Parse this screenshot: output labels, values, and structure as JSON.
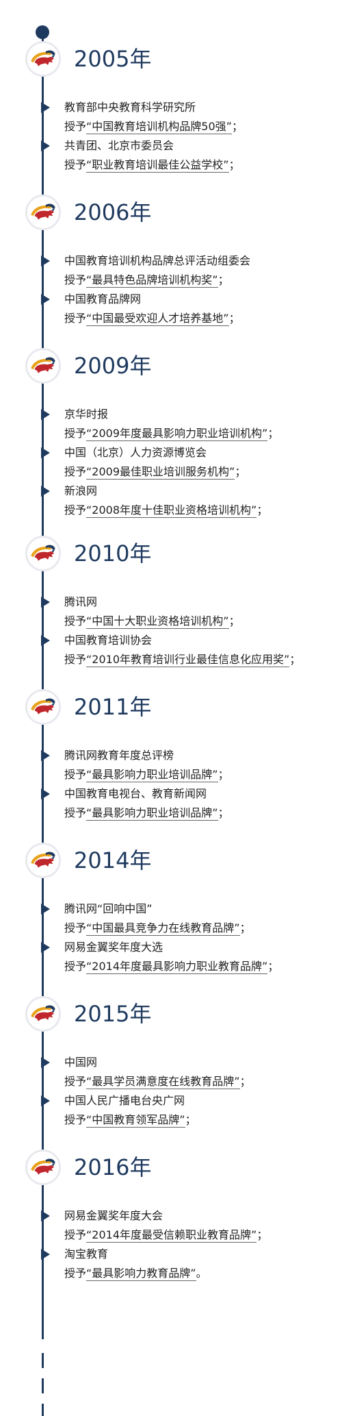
{
  "timeline": [
    {
      "year": "2005年",
      "entries": [
        {
          "source": "教育部中央教育科学研究所",
          "prefix": "授予",
          "award": "“中国教育培训机构品牌50强”",
          "suffix": "；"
        },
        {
          "source": "共青团、北京市委员会",
          "prefix": "授予",
          "award": "“职业教育培训最佳公益学校”",
          "suffix": "；"
        }
      ]
    },
    {
      "year": "2006年",
      "entries": [
        {
          "source": "中国教育培训机构品牌总评活动组委会",
          "prefix": "授予",
          "award": "“最具特色品牌培训机构奖”",
          "suffix": "；"
        },
        {
          "source": "中国教育品牌网",
          "prefix": "授予",
          "award": "“中国最受欢迎人才培养基地”",
          "suffix": "；"
        }
      ]
    },
    {
      "year": "2009年",
      "entries": [
        {
          "source": "京华时报",
          "prefix": "授予",
          "award": "“2009年度最具影响力职业培训机构”",
          "suffix": "；"
        },
        {
          "source": "中国（北京）人力资源博览会",
          "prefix": "授予",
          "award": "“2009最佳职业培训服务机构”",
          "suffix": "；"
        },
        {
          "source": "新浪网",
          "prefix": "授予",
          "award": "“2008年度十佳职业资格培训机构”",
          "suffix": "；"
        }
      ]
    },
    {
      "year": "2010年",
      "entries": [
        {
          "source": "腾讯网",
          "prefix": "授予",
          "award": "“中国十大职业资格培训机构”",
          "suffix": "；"
        },
        {
          "source": "中国教育培训协会",
          "prefix": "授予",
          "award": "“2010年教育培训行业最佳信息化应用奖”",
          "suffix": "；"
        }
      ]
    },
    {
      "year": "2011年",
      "entries": [
        {
          "source": "腾讯网教育年度总评榜",
          "prefix": "授予",
          "award": "“最具影响力职业培训品牌”",
          "suffix": "；"
        },
        {
          "source": "中国教育电视台、教育新闻网",
          "prefix": "授予",
          "award": "“最具影响力职业培训品牌”",
          "suffix": "；"
        }
      ]
    },
    {
      "year": "2014年",
      "entries": [
        {
          "source": "腾讯网“回响中国”",
          "prefix": "授予",
          "award": "“中国最具竞争力在线教育品牌”",
          "suffix": "；"
        },
        {
          "source": "网易金翼奖年度大选",
          "prefix": "授予",
          "award": "“2014年度最具影响力职业教育品牌”",
          "suffix": "；"
        }
      ]
    },
    {
      "year": "2015年",
      "entries": [
        {
          "source": "中国网",
          "prefix": "授予",
          "award": "“最具学员满意度在线教育品牌”",
          "suffix": "；"
        },
        {
          "source": "中国人民广播电台央广网",
          "prefix": "授予",
          "award": "“中国教育领军品牌”",
          "suffix": "；"
        }
      ]
    },
    {
      "year": "2016年",
      "entries": [
        {
          "source": "网易金翼奖年度大会",
          "prefix": "授予",
          "award": "“2014年度最受信赖职业教育品牌”",
          "suffix": "；"
        },
        {
          "source": "淘宝教育",
          "prefix": "授予",
          "award": "“最具影响力教育品牌”",
          "suffix": "。"
        }
      ]
    }
  ],
  "colors": {
    "line": "#1f3a5f",
    "year": "#1f3a5f",
    "logo_red": "#c0272d",
    "logo_gold": "#e8a21b",
    "logo_blue": "#1f3a5f"
  },
  "icons": {
    "logo": "bull-logo-icon",
    "arrow": "triangle-right-icon"
  }
}
